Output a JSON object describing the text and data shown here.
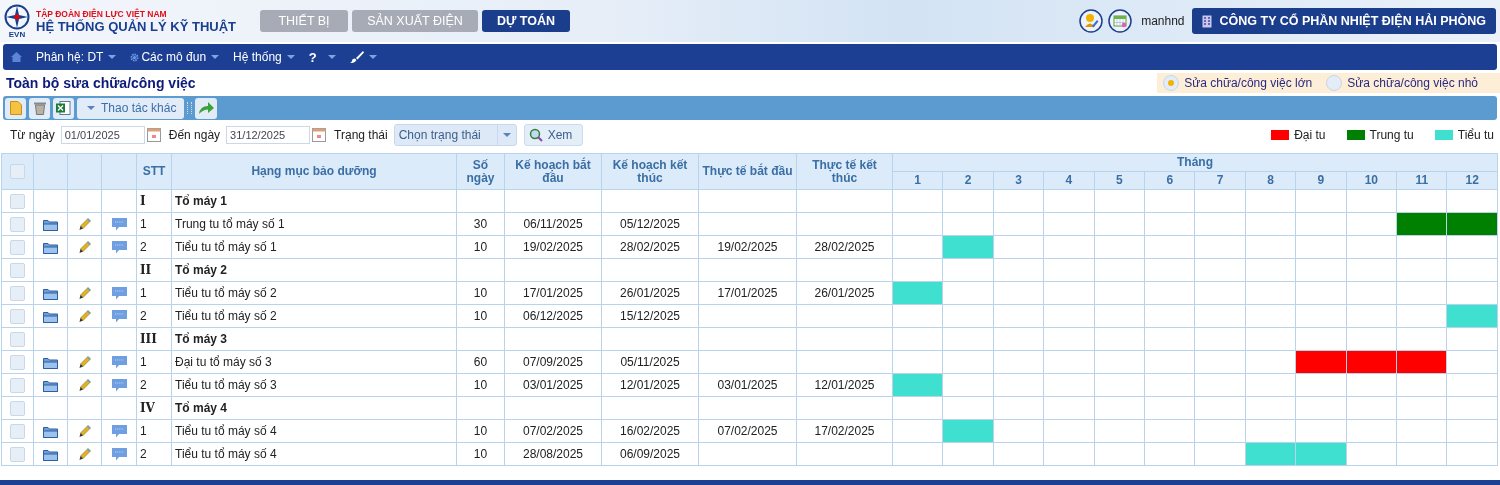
{
  "header": {
    "org": "TẬP ĐOÀN ĐIỆN LỰC VIỆT NAM",
    "system": "HỆ THỐNG QUẢN LÝ KỸ THUẬT",
    "logo_text": "EVN",
    "tabs": [
      {
        "label": "THIẾT BỊ",
        "selected": false
      },
      {
        "label": "SẢN XUẤT ĐIỆN",
        "selected": false
      },
      {
        "label": "DỰ TOÁN",
        "selected": true
      }
    ],
    "username": "manhnd",
    "company": "CÔNG TY CỔ PHẦN NHIỆT ĐIỆN HẢI PHÒNG"
  },
  "menu": [
    {
      "label": "Phân hệ: DT",
      "kind": "text"
    },
    {
      "label": "Các mô đun",
      "kind": "gear"
    },
    {
      "label": "Hệ thống",
      "kind": "text"
    },
    {
      "label": "?",
      "kind": "text"
    },
    {
      "kind": "brush"
    }
  ],
  "page_title": "Toàn bộ sửa chữa/công việc",
  "scope_options": [
    {
      "label": "Sửa chữa/công việc lớn",
      "selected": true
    },
    {
      "label": "Sửa chữa/công việc nhỏ",
      "selected": false
    }
  ],
  "toolbar": {
    "more_actions": "Thao tác khác"
  },
  "filters": {
    "from_label": "Từ ngày",
    "from": "01/01/2025",
    "to_label": "Đến ngày",
    "to": "31/12/2025",
    "status_label": "Trạng thái",
    "status_placeholder": "Chọn trạng thái",
    "view_button": "Xem"
  },
  "legend": [
    {
      "kind": "dai_tu",
      "label": "Đại tu",
      "color": "#ff0000"
    },
    {
      "kind": "trung_tu",
      "label": "Trung tu",
      "color": "#008000"
    },
    {
      "kind": "tieu_tu",
      "label": "Tiểu tu",
      "color": "#40e0d0"
    }
  ],
  "table": {
    "columns": [
      "STT",
      "Hạng mục bảo dưỡng",
      "Số ngày",
      "Kế hoạch bắt đầu",
      "Kế hoạch kết thúc",
      "Thực tế bắt đầu",
      "Thực tế kết thúc"
    ],
    "month_group": "Tháng",
    "months": [
      "1",
      "2",
      "3",
      "4",
      "5",
      "6",
      "7",
      "8",
      "9",
      "10",
      "11",
      "12"
    ],
    "header_checked": false,
    "rows": [
      {
        "kind": "group",
        "checked": false,
        "stt": "I",
        "name": "Tổ máy 1"
      },
      {
        "kind": "item",
        "checked": false,
        "stt": "1",
        "name": "Trung tu tổ máy số 1",
        "days": "30",
        "plan_start": "06/11/2025",
        "plan_end": "05/12/2025",
        "actual_start": "",
        "actual_end": "",
        "schedule": [
          {
            "kind": "none"
          },
          {
            "kind": "none"
          },
          {
            "kind": "none"
          },
          {
            "kind": "none"
          },
          {
            "kind": "none"
          },
          {
            "kind": "none"
          },
          {
            "kind": "none"
          },
          {
            "kind": "none"
          },
          {
            "kind": "none"
          },
          {
            "kind": "none"
          },
          {
            "kind": "trung_tu"
          },
          {
            "kind": "trung_tu"
          }
        ]
      },
      {
        "kind": "item",
        "checked": false,
        "stt": "2",
        "name": "Tiểu tu tổ máy số 1",
        "days": "10",
        "plan_start": "19/02/2025",
        "plan_end": "28/02/2025",
        "actual_start": "19/02/2025",
        "actual_end": "28/02/2025",
        "schedule": [
          {
            "kind": "none"
          },
          {
            "kind": "tieu_tu"
          },
          {
            "kind": "none"
          },
          {
            "kind": "none"
          },
          {
            "kind": "none"
          },
          {
            "kind": "none"
          },
          {
            "kind": "none"
          },
          {
            "kind": "none"
          },
          {
            "kind": "none"
          },
          {
            "kind": "none"
          },
          {
            "kind": "none"
          },
          {
            "kind": "none"
          }
        ]
      },
      {
        "kind": "group",
        "checked": false,
        "stt": "II",
        "name": "Tổ máy 2"
      },
      {
        "kind": "item",
        "checked": false,
        "stt": "1",
        "name": "Tiểu tu tổ máy số 2",
        "days": "10",
        "plan_start": "17/01/2025",
        "plan_end": "26/01/2025",
        "actual_start": "17/01/2025",
        "actual_end": "26/01/2025",
        "schedule": [
          {
            "kind": "tieu_tu"
          },
          {
            "kind": "none"
          },
          {
            "kind": "none"
          },
          {
            "kind": "none"
          },
          {
            "kind": "none"
          },
          {
            "kind": "none"
          },
          {
            "kind": "none"
          },
          {
            "kind": "none"
          },
          {
            "kind": "none"
          },
          {
            "kind": "none"
          },
          {
            "kind": "none"
          },
          {
            "kind": "none"
          }
        ]
      },
      {
        "kind": "item",
        "checked": false,
        "stt": "2",
        "name": "Tiểu tu tổ máy số 2",
        "days": "10",
        "plan_start": "06/12/2025",
        "plan_end": "15/12/2025",
        "actual_start": "",
        "actual_end": "",
        "schedule": [
          {
            "kind": "none"
          },
          {
            "kind": "none"
          },
          {
            "kind": "none"
          },
          {
            "kind": "none"
          },
          {
            "kind": "none"
          },
          {
            "kind": "none"
          },
          {
            "kind": "none"
          },
          {
            "kind": "none"
          },
          {
            "kind": "none"
          },
          {
            "kind": "none"
          },
          {
            "kind": "none"
          },
          {
            "kind": "tieu_tu"
          }
        ]
      },
      {
        "kind": "group",
        "checked": false,
        "stt": "III",
        "name": "Tổ máy 3"
      },
      {
        "kind": "item",
        "checked": false,
        "stt": "1",
        "name": "Đại tu tổ máy số 3",
        "days": "60",
        "plan_start": "07/09/2025",
        "plan_end": "05/11/2025",
        "actual_start": "",
        "actual_end": "",
        "schedule": [
          {
            "kind": "none"
          },
          {
            "kind": "none"
          },
          {
            "kind": "none"
          },
          {
            "kind": "none"
          },
          {
            "kind": "none"
          },
          {
            "kind": "none"
          },
          {
            "kind": "none"
          },
          {
            "kind": "none"
          },
          {
            "kind": "dai_tu"
          },
          {
            "kind": "dai_tu"
          },
          {
            "kind": "dai_tu"
          },
          {
            "kind": "none"
          }
        ]
      },
      {
        "kind": "item",
        "checked": false,
        "stt": "2",
        "name": "Tiểu tu tổ máy số 3",
        "days": "10",
        "plan_start": "03/01/2025",
        "plan_end": "12/01/2025",
        "actual_start": "03/01/2025",
        "actual_end": "12/01/2025",
        "schedule": [
          {
            "kind": "tieu_tu"
          },
          {
            "kind": "none"
          },
          {
            "kind": "none"
          },
          {
            "kind": "none"
          },
          {
            "kind": "none"
          },
          {
            "kind": "none"
          },
          {
            "kind": "none"
          },
          {
            "kind": "none"
          },
          {
            "kind": "none"
          },
          {
            "kind": "none"
          },
          {
            "kind": "none"
          },
          {
            "kind": "none"
          }
        ]
      },
      {
        "kind": "group",
        "checked": false,
        "stt": "IV",
        "name": "Tổ máy 4"
      },
      {
        "kind": "item",
        "checked": false,
        "stt": "1",
        "name": "Tiểu tu tổ máy số 4",
        "days": "10",
        "plan_start": "07/02/2025",
        "plan_end": "16/02/2025",
        "actual_start": "07/02/2025",
        "actual_end": "17/02/2025",
        "schedule": [
          {
            "kind": "none"
          },
          {
            "kind": "tieu_tu"
          },
          {
            "kind": "none"
          },
          {
            "kind": "none"
          },
          {
            "kind": "none"
          },
          {
            "kind": "none"
          },
          {
            "kind": "none"
          },
          {
            "kind": "none"
          },
          {
            "kind": "none"
          },
          {
            "kind": "none"
          },
          {
            "kind": "none"
          },
          {
            "kind": "none"
          }
        ]
      },
      {
        "kind": "item",
        "checked": false,
        "stt": "2",
        "name": "Tiểu tu tổ máy số 4",
        "days": "10",
        "plan_start": "28/08/2025",
        "plan_end": "06/09/2025",
        "actual_start": "",
        "actual_end": "",
        "schedule": [
          {
            "kind": "none"
          },
          {
            "kind": "none"
          },
          {
            "kind": "none"
          },
          {
            "kind": "none"
          },
          {
            "kind": "none"
          },
          {
            "kind": "none"
          },
          {
            "kind": "none"
          },
          {
            "kind": "tieu_tu"
          },
          {
            "kind": "tieu_tu"
          },
          {
            "kind": "none"
          },
          {
            "kind": "none"
          },
          {
            "kind": "none"
          }
        ]
      }
    ]
  }
}
